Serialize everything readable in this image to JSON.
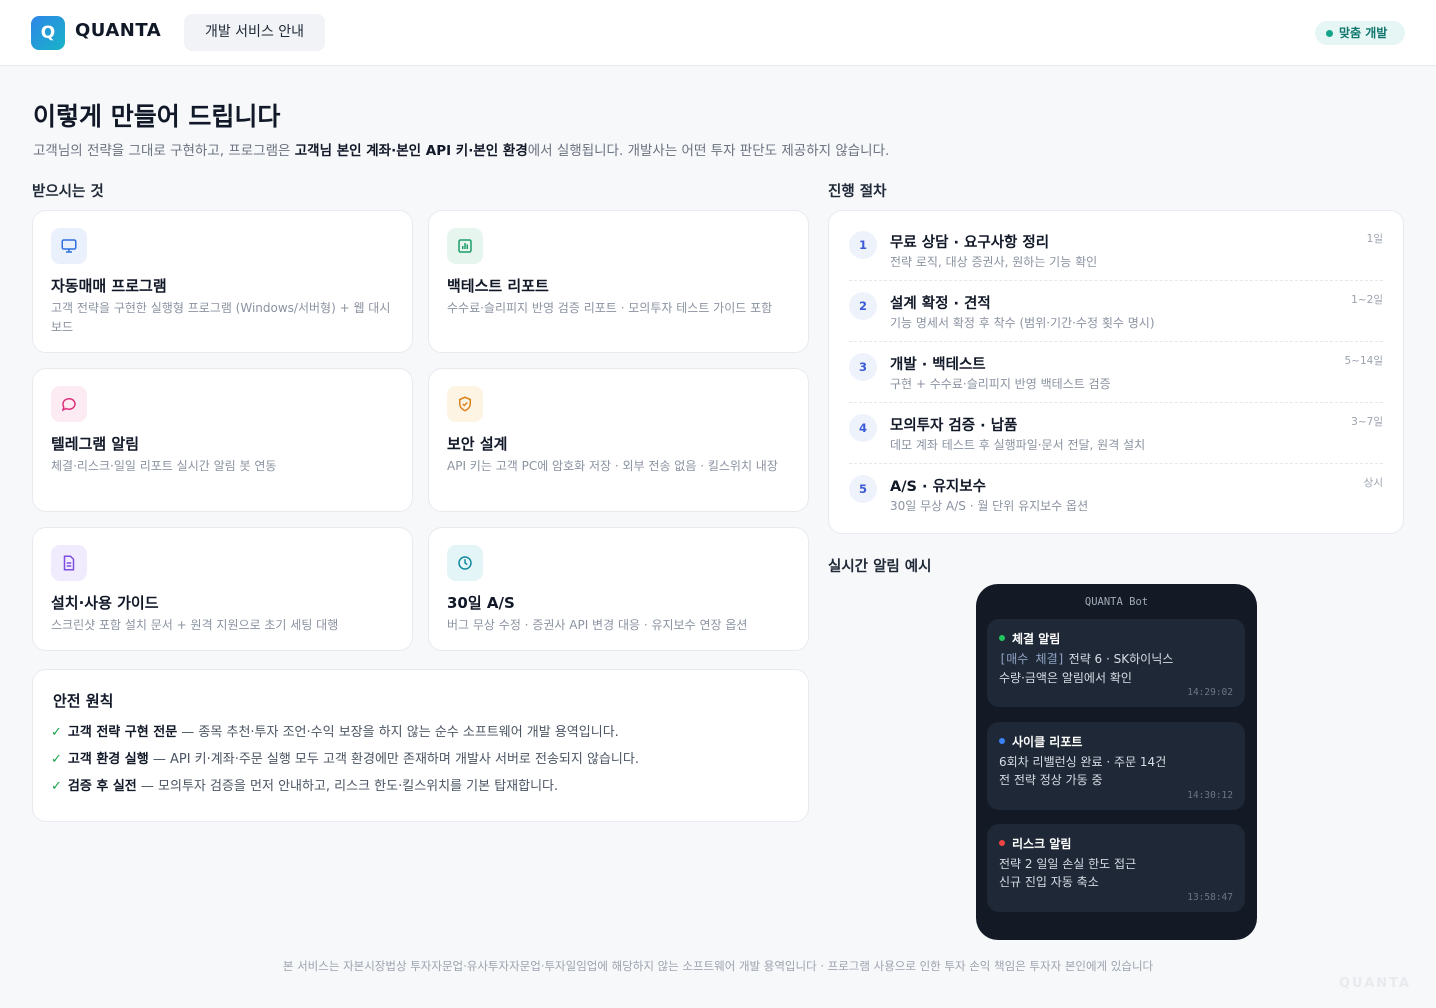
{
  "header": {
    "logo_letter": "Q",
    "brand": "QUANTA",
    "nav_label": "개발 서비스 안내",
    "badge": "맞춤 개발"
  },
  "hero": {
    "title": "이렇게 만들어 드립니다",
    "subtitle_pre": "고객님의 전략을 그대로 구현하고, 프로그램은 ",
    "subtitle_bold": "고객님 본인 계좌·본인 API 키·본인 환경",
    "subtitle_post": "에서 실행됩니다. 개발사는 어떤 투자 판단도 제공하지 않습니다."
  },
  "deliverables": {
    "section_label": "받으시는 것",
    "items": [
      {
        "title": "자동매매 프로그램",
        "desc": "고객 전략을 구현한 실행형 프로그램 (Windows/서버형) + 웹 대시보드",
        "icon": "monitor-icon",
        "icon_bg": "#eaf1fd",
        "icon_color": "#2f6fe0"
      },
      {
        "title": "백테스트 리포트",
        "desc": "수수료·슬리피지 반영 검증 리포트 · 모의투자 테스트 가이드 포함",
        "icon": "chart-icon",
        "icon_bg": "#e6f6ef",
        "icon_color": "#1f9d68"
      },
      {
        "title": "텔레그램 알림",
        "desc": "체결·리스크·일일 리포트 실시간 알림 봇 연동",
        "icon": "chat-icon",
        "icon_bg": "#fdebf3",
        "icon_color": "#db2f7b"
      },
      {
        "title": "보안 설계",
        "desc": "API 키는 고객 PC에 암호화 저장 · 외부 전송 없음 · 킬스위치 내장",
        "icon": "shield-icon",
        "icon_bg": "#fef4e4",
        "icon_color": "#d9821a"
      },
      {
        "title": "설치·사용 가이드",
        "desc": "스크린샷 포함 설치 문서 + 원격 지원으로 초기 세팅 대행",
        "icon": "document-icon",
        "icon_bg": "#f1ecfd",
        "icon_color": "#7c4fe0"
      },
      {
        "title": "30일 A/S",
        "desc": "버그 무상 수정 · 증권사 API 변경 대응 · 유지보수 연장 옵션",
        "icon": "clock-icon",
        "icon_bg": "#e4f5f7",
        "icon_color": "#138aa0"
      }
    ]
  },
  "safety": {
    "title": "안전 원칙",
    "items": [
      {
        "bold": "고객 전략 구현 전문",
        "text": " — 종목 추천·투자 조언·수익 보장을 하지 않는 순수 소프트웨어 개발 용역입니다."
      },
      {
        "bold": "고객 환경 실행",
        "text": " — API 키·계좌·주문 실행 모두 고객 환경에만 존재하며 개발사 서버로 전송되지 않습니다."
      },
      {
        "bold": "검증 후 실전",
        "text": " — 모의투자 검증을 먼저 안내하고, 리스크 한도·킬스위치를 기본 탑재합니다."
      }
    ]
  },
  "process": {
    "section_label": "진행 절차",
    "steps": [
      {
        "num": "1",
        "title": "무료 상담 · 요구사항 정리",
        "desc": "전략 로직, 대상 증권사, 원하는 기능 확인",
        "duration": "1일"
      },
      {
        "num": "2",
        "title": "설계 확정 · 견적",
        "desc": "기능 명세서 확정 후 착수 (범위·기간·수정 횟수 명시)",
        "duration": "1~2일"
      },
      {
        "num": "3",
        "title": "개발 · 백테스트",
        "desc": "구현 + 수수료·슬리피지 반영 백테스트 검증",
        "duration": "5~14일"
      },
      {
        "num": "4",
        "title": "모의투자 검증 · 납품",
        "desc": "데모 계좌 테스트 후 실행파일·문서 전달, 원격 설치",
        "duration": "3~7일"
      },
      {
        "num": "5",
        "title": "A/S · 유지보수",
        "desc": "30일 무상 A/S · 월 단위 유지보수 옵션",
        "duration": "상시"
      }
    ]
  },
  "alerts": {
    "section_label": "실시간 알림 예시",
    "bot_name": "QUANTA Bot",
    "messages": [
      {
        "title": "체결 알림",
        "dot_color": "#22c55e",
        "line1_tag": "[매수 체결]",
        "line1": " 전략 6 · SK하이닉스",
        "line2": "수량·금액은 알림에서 확인",
        "time": "14:29:02"
      },
      {
        "title": "사이클 리포트",
        "dot_color": "#3b82f6",
        "line1_tag": "",
        "line1": "6회차 리밸런싱 완료 · 주문 14건",
        "line2": "전 전략 정상 가동 중",
        "time": "14:30:12"
      },
      {
        "title": "리스크 알림",
        "dot_color": "#ef4444",
        "line1_tag": "",
        "line1": "전략 2 일일 손실 한도 접근",
        "line2": "신규 진입 자동 축소",
        "time": "13:58:47"
      }
    ]
  },
  "footer": {
    "note": "본 서비스는 자본시장법상 투자자문업·유사투자자문업·투자일임업에 해당하지 않는 소프트웨어 개발 용역입니다 · 프로그램 사용으로 인한 투자 손익 책임은 투자자 본인에게 있습니다",
    "watermark": "QUANTA"
  }
}
